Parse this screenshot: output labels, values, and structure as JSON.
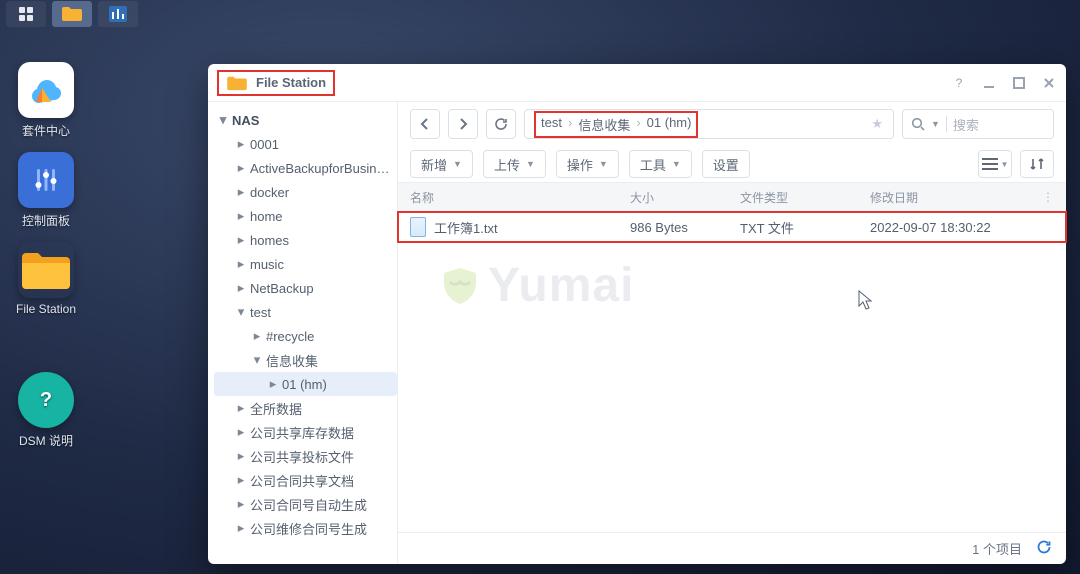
{
  "taskbar": {
    "items": [
      "apps",
      "file-station",
      "equalizer"
    ]
  },
  "desktop": [
    {
      "label": "套件中心",
      "kind": "package-center"
    },
    {
      "label": "控制面板",
      "kind": "control-panel"
    },
    {
      "label": "File Station",
      "kind": "file-station"
    },
    {
      "label": "DSM 说明",
      "kind": "help"
    }
  ],
  "window": {
    "title": "File Station",
    "breadcrumb": [
      "test",
      "信息收集",
      "01 (hm)"
    ],
    "search": {
      "placeholder": "搜索"
    },
    "toolbar": {
      "new": "新增",
      "upload": "上传",
      "action": "操作",
      "tools": "工具",
      "settings": "设置"
    },
    "columns": {
      "name": "名称",
      "size": "大小",
      "type": "文件类型",
      "modified": "修改日期"
    },
    "rows": [
      {
        "name": "工作簿1.txt",
        "size": "986 Bytes",
        "type": "TXT 文件",
        "modified": "2022-09-07 18:30:22"
      }
    ],
    "status": {
      "count": "1 个项目"
    }
  },
  "tree": {
    "root": "NAS",
    "nodes": [
      {
        "label": "0001",
        "depth": 1,
        "expanded": false
      },
      {
        "label": "ActiveBackupforBusiness",
        "depth": 1,
        "expanded": false
      },
      {
        "label": "docker",
        "depth": 1,
        "expanded": false
      },
      {
        "label": "home",
        "depth": 1,
        "expanded": false
      },
      {
        "label": "homes",
        "depth": 1,
        "expanded": false
      },
      {
        "label": "music",
        "depth": 1,
        "expanded": false
      },
      {
        "label": "NetBackup",
        "depth": 1,
        "expanded": false
      },
      {
        "label": "test",
        "depth": 1,
        "expanded": true
      },
      {
        "label": "#recycle",
        "depth": 2,
        "expanded": false
      },
      {
        "label": "信息收集",
        "depth": 2,
        "expanded": true
      },
      {
        "label": "01 (hm)",
        "depth": 3,
        "expanded": false,
        "selected": true
      },
      {
        "label": "全所数据",
        "depth": 1,
        "expanded": false
      },
      {
        "label": "公司共享库存数据",
        "depth": 1,
        "expanded": false
      },
      {
        "label": "公司共享投标文件",
        "depth": 1,
        "expanded": false
      },
      {
        "label": "公司合同共享文档",
        "depth": 1,
        "expanded": false
      },
      {
        "label": "公司合同号自动生成",
        "depth": 1,
        "expanded": false
      },
      {
        "label": "公司维修合同号生成",
        "depth": 1,
        "expanded": false
      }
    ]
  },
  "watermark": "Yumai"
}
